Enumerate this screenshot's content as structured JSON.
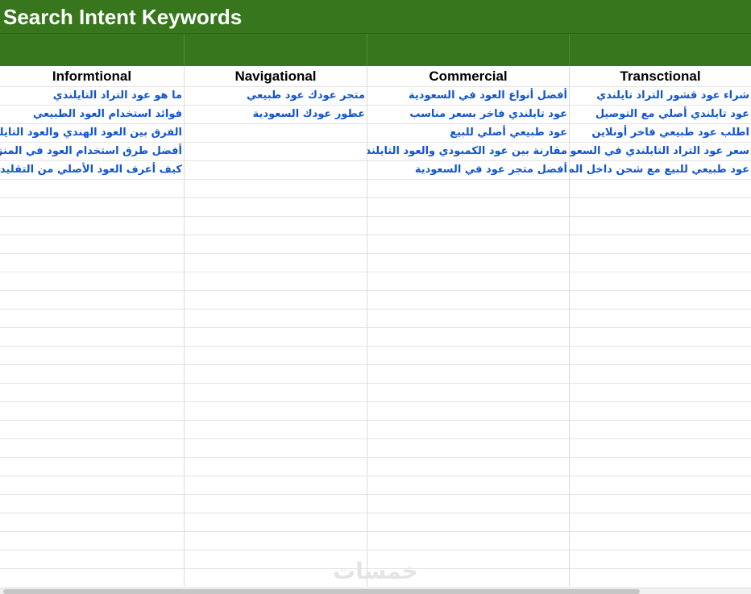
{
  "sheet": {
    "title": "Search Intent Keywords",
    "columns": [
      {
        "header": "Informtional",
        "keywords": [
          "ما هو عود التراد التايلندي",
          "فوائد استخدام العود الطبيعي",
          "الفرق بين العود الهندي والعود التايلندي",
          "أفضل طرق استخدام العود في المنزل",
          "كيف أعرف العود الأصلي من التقليد"
        ]
      },
      {
        "header": "Navigational",
        "keywords": [
          "متجر عودك عود طبيعي",
          "عطور عودك السعودية"
        ]
      },
      {
        "header": "Commercial",
        "keywords": [
          "أفضل أنواع العود في السعودية",
          "عود تايلندي فاخر بسعر مناسب",
          "عود طبيعي أصلي للبيع",
          "مقارنة بين عود الكمبودي والعود التايلندي",
          "أفضل متجر عود في السعودية"
        ]
      },
      {
        "header": "Transctional",
        "keywords": [
          "شراء عود قشور التراد تايلندي",
          "عود تايلندي أصلي مع التوصيل",
          "اطلب عود طبيعي فاخر أونلاين",
          "سعر عود التراد التايلندي في السعودية",
          "عود طبيعي للبيع مع شحن داخل المملكة"
        ]
      }
    ]
  },
  "watermark": "خمسات",
  "colors": {
    "header_green": "#38761d",
    "keyword_blue": "#1155cc",
    "grid_line": "#e3e3e3"
  }
}
